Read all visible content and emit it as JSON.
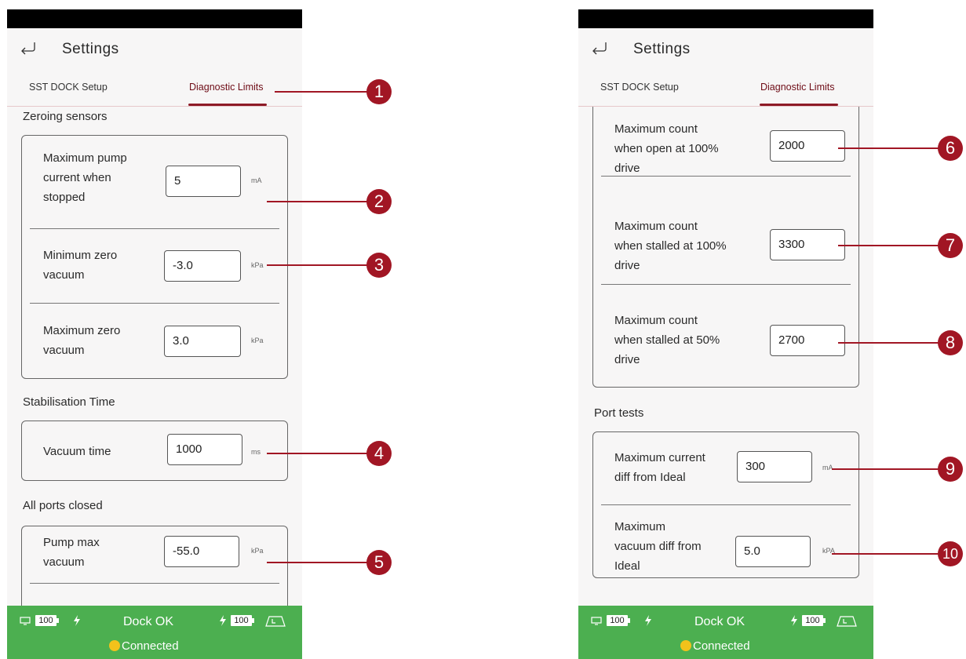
{
  "app": {
    "title": "Settings",
    "tabs": [
      "SST DOCK Setup",
      "Diagnostic Limits"
    ]
  },
  "left_screen": {
    "sections": {
      "zeroing": "Zeroing sensors",
      "stabilisation": "Stabilisation Time",
      "all_ports": "All ports closed"
    },
    "rows": {
      "pump_current": {
        "label_lines": [
          "Maximum pump",
          "current when",
          "stopped"
        ],
        "value": "5",
        "unit": "mA"
      },
      "min_zero": {
        "label_lines": [
          "Minimum zero",
          "vacuum"
        ],
        "value": "-3.0",
        "unit": "kPa"
      },
      "max_zero": {
        "label_lines": [
          "Maximum zero",
          "vacuum"
        ],
        "value": "3.0",
        "unit": "kPa"
      },
      "vacuum_time": {
        "label_lines": [
          "Vacuum time"
        ],
        "value": "1000",
        "unit": "ms"
      },
      "pump_max": {
        "label_lines": [
          "Pump max",
          "vacuum"
        ],
        "value": "-55.0",
        "unit": "kPa"
      }
    }
  },
  "right_screen": {
    "sections": {
      "port_tests": "Port tests"
    },
    "rows": {
      "open_100": {
        "label_lines": [
          "Maximum count",
          "when open at 100%",
          "drive"
        ],
        "value": "2000"
      },
      "stalled_100": {
        "label_lines": [
          "Maximum count",
          "when stalled at 100%",
          "drive"
        ],
        "value": "3300"
      },
      "stalled_50": {
        "label_lines": [
          "Maximum count",
          "when stalled at 50%",
          "drive"
        ],
        "value": "2700"
      },
      "current_diff": {
        "label_lines": [
          "Maximum current",
          "diff from Ideal"
        ],
        "value": "300",
        "unit": "mA"
      },
      "vacuum_diff": {
        "label_lines": [
          "Maximum",
          "vacuum diff from",
          "Ideal"
        ],
        "value": "5.0",
        "unit": "kPA"
      }
    }
  },
  "footer": {
    "tablet_battery": "100",
    "dock_status": "Dock OK",
    "pump_battery": "100",
    "connection": "Connected"
  },
  "callouts": [
    "1",
    "2",
    "3",
    "4",
    "5",
    "6",
    "7",
    "8",
    "9",
    "10"
  ],
  "colors": {
    "accent": "#a11624",
    "status_bar": "#4caf50",
    "background": "#f7f6f6"
  }
}
